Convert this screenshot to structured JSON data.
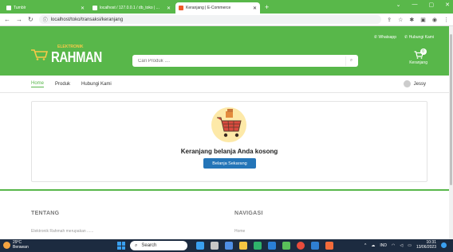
{
  "browser": {
    "tabs": [
      {
        "label": "Tumblr",
        "active": false
      },
      {
        "label": "localhost / 127.0.0.1 / db_toko | ...",
        "active": false
      },
      {
        "label": "Keranjang | E-Commerce",
        "active": true
      }
    ],
    "new_tab": "+",
    "url": "localhost/toko/transaksi/keranjang"
  },
  "header": {
    "whatsapp_link": "Whatsapp",
    "contact_link": "Hubungi Kami",
    "logo_small": "ELEKTRONIK",
    "logo_text": "RAHMAN",
    "search_placeholder": "Cari Produk ....",
    "cart_label": "Keranjang",
    "cart_count": "0"
  },
  "nav": {
    "items": [
      "Home",
      "Produk",
      "Hubungi Kami"
    ],
    "user_name": "Jessy"
  },
  "main": {
    "empty_title": "Keranjang belanja Anda kosong",
    "shop_button": "Belanja Sekarang"
  },
  "footer": {
    "about_title": "TENTANG",
    "about_text": "Elektronik Rahmah merupakan ......",
    "nav_title": "NAVIGASI",
    "nav_first": "Home"
  },
  "taskbar": {
    "temperature": "29°C",
    "weather": "Berawan",
    "search_label": "Search",
    "lang": "IND",
    "time": "10:31",
    "date": "13/06/2023"
  },
  "colors": {
    "brand_green": "#58b74a",
    "button_blue": "#2475b8",
    "taskbar": "#1c2b40"
  }
}
